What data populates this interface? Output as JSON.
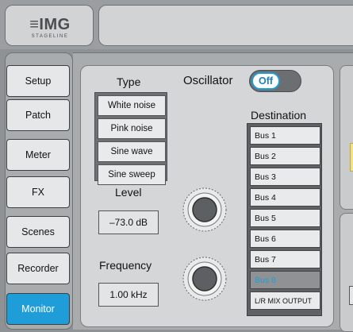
{
  "logo": {
    "main": "≡IMG",
    "sub": "STAGELINE"
  },
  "nav": {
    "items": [
      {
        "label": "Setup"
      },
      {
        "label": "Patch"
      },
      {
        "label": "Meter"
      },
      {
        "label": "FX"
      },
      {
        "label": "Scenes"
      },
      {
        "label": "Recorder"
      },
      {
        "label": "Monitor",
        "active": true
      }
    ]
  },
  "oscillator": {
    "title": "Oscillator",
    "toggle_label": "Off",
    "type_heading": "Type",
    "types": [
      "White noise",
      "Pink noise",
      "Sine wave",
      "Sine sweep"
    ],
    "level_heading": "Level",
    "level_value": "–73.0 dB",
    "frequency_heading": "Frequency",
    "frequency_value": "1.00 kHz",
    "destination_heading": "Destination",
    "destinations": [
      "Bus 1",
      "Bus 2",
      "Bus 3",
      "Bus 4",
      "Bus 5",
      "Bus 6",
      "Bus 7",
      "Bus 8",
      "L/R MIX OUTPUT"
    ],
    "selected_destination": "Bus 8"
  },
  "colors": {
    "accent": "#1f9dd9",
    "panel": "#d4d6d7",
    "background": "#8f9294"
  }
}
